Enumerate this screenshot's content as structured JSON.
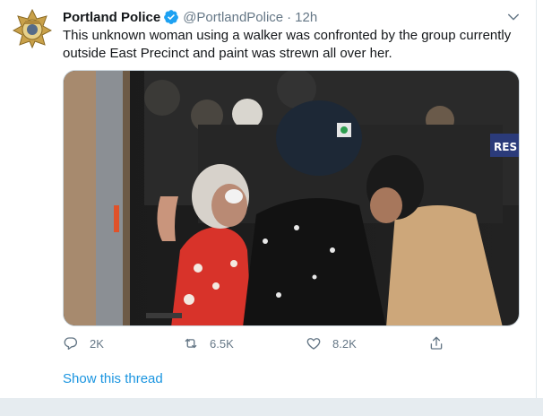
{
  "tweet": {
    "author": {
      "name": "Portland Police",
      "handle": "@PortlandPolice",
      "time": "12h",
      "separator": "·",
      "avatar_icon": "police-badge-icon",
      "verified_icon": "verified-badge-icon"
    },
    "text": "This unknown woman using a walker was confronted by the group currently outside East Precinct and paint was strewn all over her.",
    "media": {
      "type": "photo",
      "overlay_sign_text": "RES"
    },
    "actions": {
      "replies": "2K",
      "retweets": "6.5K",
      "likes": "8.2K"
    },
    "show_thread_label": "Show this thread"
  },
  "colors": {
    "link": "#1b95e0",
    "secondary_text": "#657786",
    "verified": "#1da1f2"
  }
}
